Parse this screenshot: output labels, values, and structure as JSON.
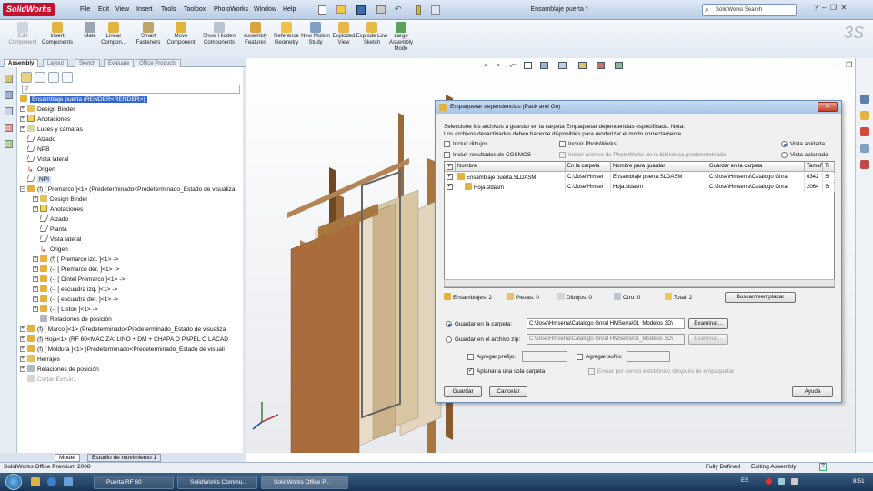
{
  "app": {
    "logo": "SolidWorks",
    "doc_title": "Ensamblaje puerta *",
    "search_placeholder": "SolidWorks Search"
  },
  "menu": [
    "File",
    "Edit",
    "View",
    "Insert",
    "Tools",
    "Toolbox",
    "PhotoWorks",
    "Window",
    "Help"
  ],
  "commands": [
    "Edit Component",
    "Insert Components",
    "Mate",
    "Linear Compon...",
    "Smart Fasteners",
    "Move Component",
    "Show Hidden Components",
    "Assembly Features",
    "Reference Geometry",
    "New Motion Study",
    "Exploded View",
    "Explode Line Sketch",
    "Large Assembly Mode"
  ],
  "tabs": [
    "Assembly",
    "Layout",
    "Sketch",
    "Evaluate",
    "Office Products"
  ],
  "tree": {
    "root": "Ensamblaje puerta  (RENDER<RENDER>)",
    "items": [
      "Design Binder",
      "Anotaciones",
      "Luces y cámaras",
      "Alzado",
      "NPB",
      "Vista lateral",
      "Origen",
      "NPI",
      "(f) [ Premarco ]<1> (Predeterminado<Predeterminado_Estado de visualiza",
      "Design Binder",
      "Anotaciones",
      "Alzado",
      "Planta",
      "Vista lateral",
      "Origen",
      "(f) [ Premarco izq. ]<1> ->",
      "(-) [ Premarco der. ]<1> ->",
      "(-) [ Dintel Premarco ]<1> ->",
      "(-) [ escuadra izq. ]<1> ->",
      "(-) [ escuadra der. ]<1> ->",
      "(-) [ Liston ]<1> ->",
      "Relaciones de posición",
      "(f) [ Marco ]<1> (Predeterminado<Predeterminado_Estado de visualiza",
      "(f) Hoja<1> (RF 60<MACIZA: LINO + DM + CHAPA O PAPEL O LACAD",
      "(f) [ Moldura ]<1> (Predeterminado<Predeterminado_Estado de visuali",
      "Herrajes",
      "Relaciones de posición",
      "Cortar-Extruir1"
    ]
  },
  "bottom_tabs": [
    "Model",
    "Estudio de movimiento 1"
  ],
  "status": {
    "product": "SolidWorks Office Premium 2008",
    "defined": "Fully Defined",
    "mode": "Editing Assembly"
  },
  "taskbar": {
    "items": [
      "Puerta RF 60",
      "SolidWorks Commu...",
      "SolidWorks Office P..."
    ],
    "lang": "ES",
    "time": "8:51"
  },
  "dialog": {
    "title": "Empaquetar dependencias  (Pack and Go)",
    "intro1": "Seleccione los archivos a guardar en la carpeta Empaquetar dependencias especificada. Nota:",
    "intro2": "Los archivos desactivados deben hacerse disponibles para renderizar el modo correctamente.",
    "opt_drawings": "Incluir dibujos",
    "opt_photoworks": "Incluir PhotoWorks",
    "opt_cosmos": "Incluir resultados de COSMOS",
    "opt_pw_lib": "Incluir archivo de PhotoWorks de la biblioteca predeterminada",
    "view_nested": "Vista anidada",
    "view_flat": "Vista aplanada",
    "columns": [
      "Nombre",
      "En la carpeta",
      "Nombre para guardar",
      "Guardar en la carpeta",
      "Tamaño",
      "Ti"
    ],
    "rows": [
      {
        "name": "Ensamblaje puerta.SLDASM",
        "folder": "C:\\Jose\\Hmser",
        "save_name": "Ensamblaje puerta.SLDASM",
        "save_folder": "C:\\Jose\\Hmserra\\Catalogo Gnral",
        "size": "6342",
        "type": "Sr"
      },
      {
        "name": "Hoja.sldasm",
        "folder": "C:\\Jose\\Hmser",
        "save_name": "Hoja.sldasm",
        "save_folder": "C:\\Jose\\Hmserra\\Catalogo Gnral",
        "size": "2064",
        "type": "Sr"
      }
    ],
    "summary": {
      "assemblies": "Ensamblajes: 2",
      "parts": "Piezas: 0",
      "drawings": "Dibujos: 0",
      "others": "Otro: 0",
      "total": "Total: 2"
    },
    "replace_btn": "Buscar/reemplazar",
    "save_folder_label": "Guardar en la carpeta:",
    "save_folder_value": "C:\\Jose\\Hmserra\\Catalogo Gnral HMSerra\\01_Modelos 3D\\",
    "save_zip_label": "Guardar en el archivo zip:",
    "save_zip_value": "C:\\Jose\\Hmserra\\Catalogo Gnral HMSerra\\01_Modelos 3D\\",
    "browse": "Examinar...",
    "prefix": "Agregar prefijo:",
    "suffix": "Agregar sufijo:",
    "flatten": "Aplanar a una sola carpeta",
    "email": "Enviar por correo electrónico después de empaquetar",
    "save_btn": "Guardar",
    "cancel_btn": "Cancelar",
    "help_btn": "Ayuda"
  }
}
